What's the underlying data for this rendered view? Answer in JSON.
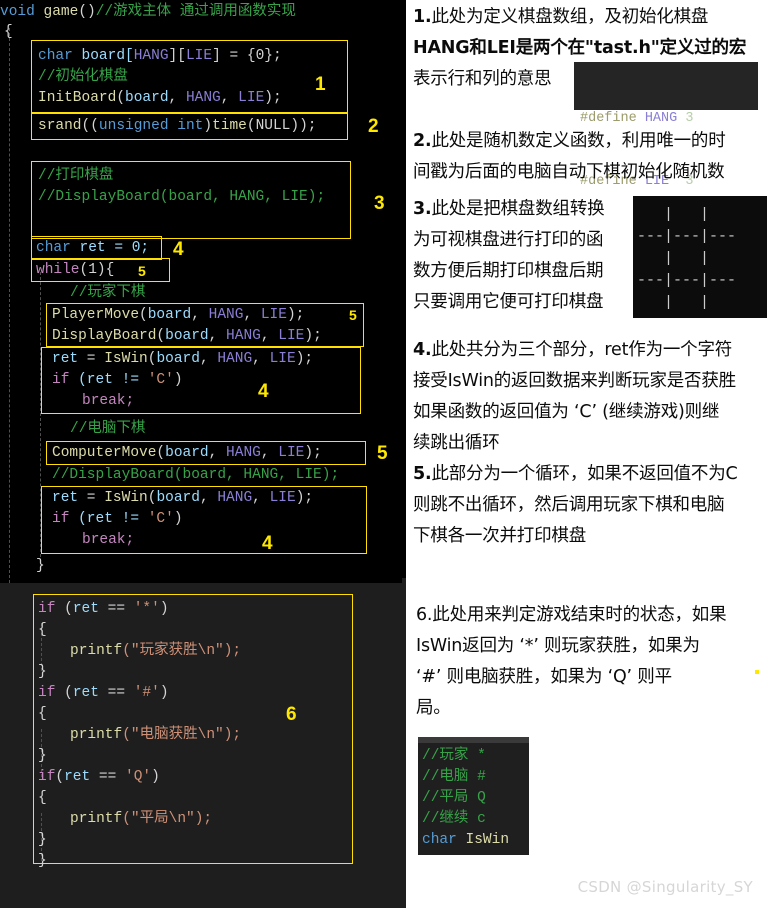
{
  "meta": {
    "watermark": "CSDN @Singularity_SY"
  },
  "code": {
    "top": {
      "signature_kw": "void",
      "signature_fn": "game",
      "signature_parens": "()",
      "signature_comment": "//游戏主体 通过调用函数实现",
      "open_brace": "{",
      "line_board_decl_type": "char",
      "line_board_decl_name": " board[",
      "line_board_decl_hang": "HANG",
      "line_board_decl_mid": "][",
      "line_board_decl_lie": "LIE",
      "line_board_decl_end": "] = {0};",
      "comment_init_board": "//初始化棋盘",
      "call_initboard_fn": "InitBoard",
      "call_initboard_args_open": "(",
      "call_initboard_board": "board",
      "call_initboard_comma1": ", ",
      "call_initboard_hang": "HANG",
      "call_initboard_comma2": ", ",
      "call_initboard_lie": "LIE",
      "call_initboard_close": ");",
      "srand_fn": "srand",
      "srand_open": "((",
      "srand_unsigned": "unsigned",
      "srand_space": " ",
      "srand_int": "int",
      "srand_close1": ")",
      "srand_time": "time",
      "srand_null": "(NULL));",
      "comment_print_board": "//打印棋盘",
      "comment_displayboard": "//DisplayBoard(board, HANG, LIE);",
      "ret_decl_type": "char",
      "ret_decl_rest": " ret = 0;",
      "while_kw": "while",
      "while_rest": "(1){",
      "comment_player_move": "//玩家下棋",
      "playermove_fn": "PlayerMove",
      "displayboard_fn": "DisplayBoard",
      "args_board": "board",
      "args_hang": "HANG",
      "args_lie": "LIE",
      "ret_assign_var": "ret",
      "ret_assign_eq": " = ",
      "iswin_fn": "IsWin",
      "if_kw": "if",
      "if_cond_var": " (ret != ",
      "if_cond_char": "'C'",
      "if_cond_close": ")",
      "break_kw": "break;",
      "comment_computer_move": "//电脑下棋",
      "computermove_fn": "ComputerMove",
      "comment_displayboard2": "//DisplayBoard(board, HANG, LIE);",
      "close_brace": "}"
    },
    "bottom": {
      "if_star_kw": "if",
      "if_star_open": " (",
      "if_star_var": "ret",
      "if_star_eq": " == ",
      "if_star_char": "'*'",
      "if_star_close": ")",
      "brace_open": "{",
      "printf_fn": "printf",
      "printf_player_arg": "(\"玩家获胜\\n\");",
      "brace_close": "}",
      "if_hash_char": "'#'",
      "printf_computer_arg": "(\"电脑获胜\\n\");",
      "if_q_kw": "if",
      "if_q_open": "(",
      "if_q_var": "ret",
      "if_q_eq": " == ",
      "if_q_char": "'Q'",
      "if_q_close": ")",
      "printf_draw_arg": "(\"平局\\n\");"
    }
  },
  "markers": {
    "m1": "1",
    "m2": "2",
    "m3": "3",
    "m4a": "4",
    "m5a": "5",
    "m5b": "5",
    "m4b": "4",
    "m5c": "5",
    "m4c": "4",
    "m6": "6"
  },
  "notes": {
    "n1_line1_num": "1.",
    "n1_line1": "此处为定义棋盘数组，及初始化棋盘",
    "n1_line2": "HANG和LEI是两个在\"tast.h\"定义过的宏",
    "n1_line3": "表示行和列的意思",
    "n2_num": "2.",
    "n2_line1": "此处是随机数定义函数，利用唯一的时",
    "n2_line2": "间戳为后面的电脑自动下棋初始化随机数",
    "n3_num": "3.",
    "n3_line1": "此处是把棋盘数组转换",
    "n3_line2": "为可视棋盘进行打印的函",
    "n3_line3": "数方便后期打印棋盘后期",
    "n3_line4": "只要调用它便可打印棋盘",
    "n4_num": "4.",
    "n4_line1": "此处共分为三个部分，ret作为一个字符",
    "n4_line2": "接受IsWin的返回数据来判断玩家是否获胜",
    "n4_line3": "如果函数的返回值为 ‘C’ (继续游戏)则继",
    "n4_line4": "续跳出循环",
    "n5_num": "5.",
    "n5_line1": "此部分为一个循环，如果不返回值不为C",
    "n5_line2": "则跳不出循环，然后调用玩家下棋和电脑",
    "n5_line3": "下棋各一次并打印棋盘",
    "n6_num": "6.",
    "n6_line1": "此处用来判定游戏结束时的状态，如果",
    "n6_line2": "IsWin返回为 ‘*’ 则玩家获胜，如果为",
    "n6_line3": " ‘#’ 则电脑获胜，如果为 ‘Q’ 则平",
    "n6_line4": "局。"
  },
  "define_snippet": {
    "l1_kw": "#define",
    "l1_name": " HANG",
    "l1_val": " 3",
    "l2_kw": "#define",
    "l2_name": " LIE",
    "l2_val": "  3"
  },
  "board_terminal": {
    "rows": [
      "   |   |   ",
      "---|---|---",
      "   |   |   ",
      "---|---|---",
      "   |   |   "
    ]
  },
  "iswin_snippet": {
    "l1": "//玩家 *",
    "l2": "//电脑 #",
    "l3": "//平局 Q",
    "l4": "//继续 c",
    "l5_type": "char",
    "l5_fn": " IsWin"
  },
  "colors": {
    "marker_yellow": "#ffe800",
    "box_yellow": "#ffe000",
    "comment_green": "#37a349",
    "keyword_purple": "#c586c0",
    "type_blue": "#569cd6",
    "code_bg_top": "#000000",
    "code_bg_bottom": "#1e1e1e"
  }
}
